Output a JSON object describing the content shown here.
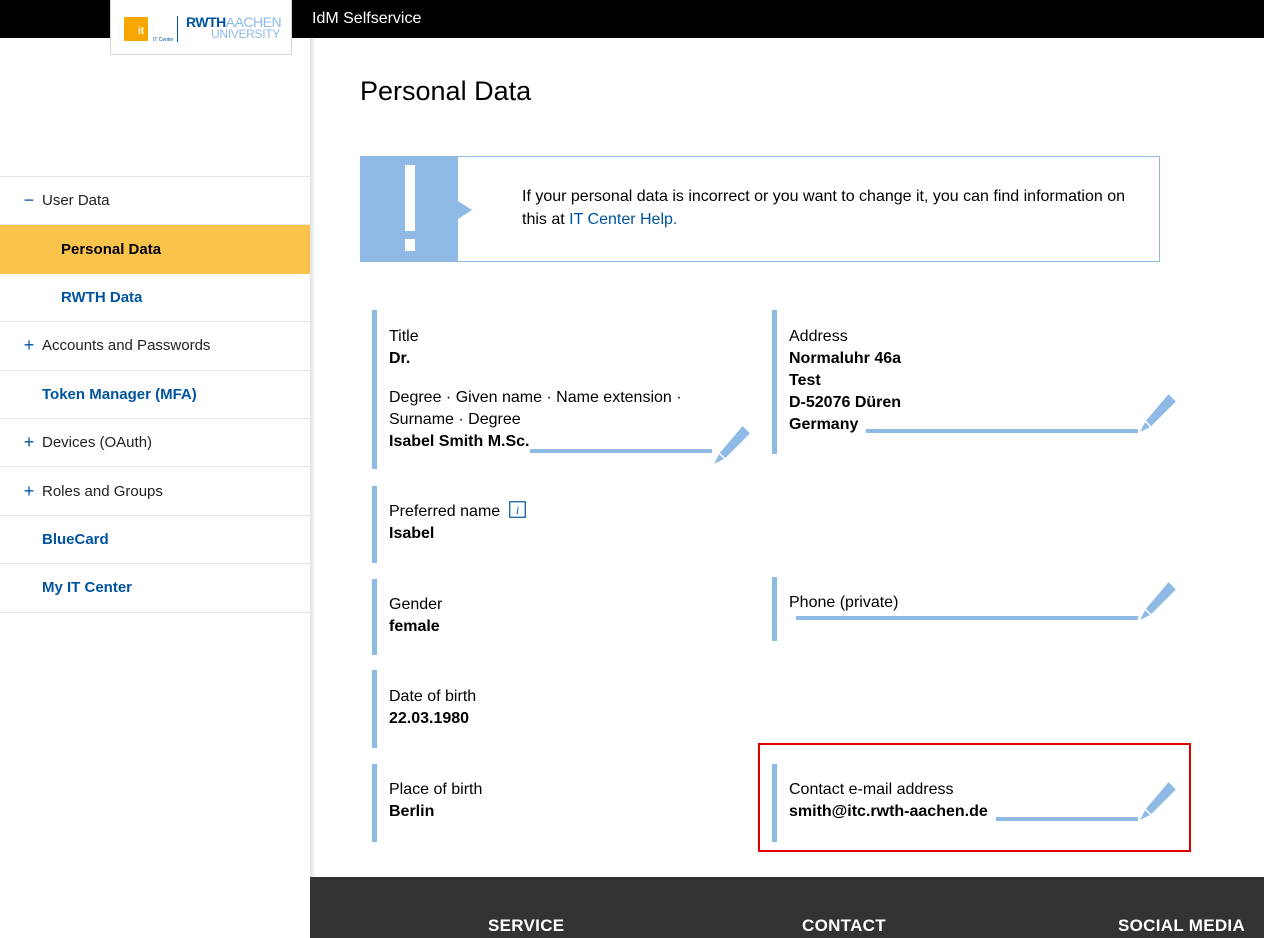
{
  "header": {
    "app_title": "IdM Selfservice",
    "logo": {
      "it": "it",
      "it_center": "IT Center",
      "rwth": "RWTH",
      "aachen": "AACHEN",
      "university": "UNIVERSITY"
    }
  },
  "sidebar": {
    "items": [
      {
        "sign": "−",
        "label": "User Data"
      },
      {
        "label": "Personal Data"
      },
      {
        "label": "RWTH Data"
      },
      {
        "sign": "+",
        "label": "Accounts and Passwords"
      },
      {
        "label": "Token Manager (MFA)"
      },
      {
        "sign": "+",
        "label": "Devices (OAuth)"
      },
      {
        "sign": "+",
        "label": "Roles and Groups"
      },
      {
        "label": "BlueCard"
      },
      {
        "label": "My IT Center"
      }
    ]
  },
  "main": {
    "title": "Personal Data",
    "info": {
      "text": "If your personal data is incorrect or you want to change it, you can find information on this at ",
      "link": "IT Center Help."
    },
    "fields": {
      "title_label": "Title",
      "title_value": "Dr.",
      "name_label": "Degree · Given name · Name extension · Surname · Degree",
      "name_value": "Isabel Smith M.Sc.",
      "address_label": "Address",
      "address_line1": "Normaluhr 46a",
      "address_line2": "Test",
      "address_line3": "D-52076 Düren",
      "address_line4": "Germany",
      "preferred_label": "Preferred name",
      "preferred_value": "Isabel",
      "gender_label": "Gender",
      "gender_value": "female",
      "phone_label": "Phone (private)",
      "dob_label": "Date of birth",
      "dob_value": "22.03.1980",
      "pob_label": "Place of birth",
      "pob_value": "Berlin",
      "email_label": "Contact e-mail address",
      "email_value": "smith@itc.rwth-aachen.de"
    }
  },
  "footer": {
    "service": "SERVICE",
    "contact": "CONTACT",
    "social": "SOCIAL MEDIA"
  },
  "colors": {
    "accent": "#00549f",
    "light_blue": "#8ebae5",
    "active": "#fac34c",
    "highlight": "#e00000"
  },
  "icons": {
    "edit": "pencil-icon",
    "info": "info-icon",
    "notice": "exclamation-icon"
  }
}
